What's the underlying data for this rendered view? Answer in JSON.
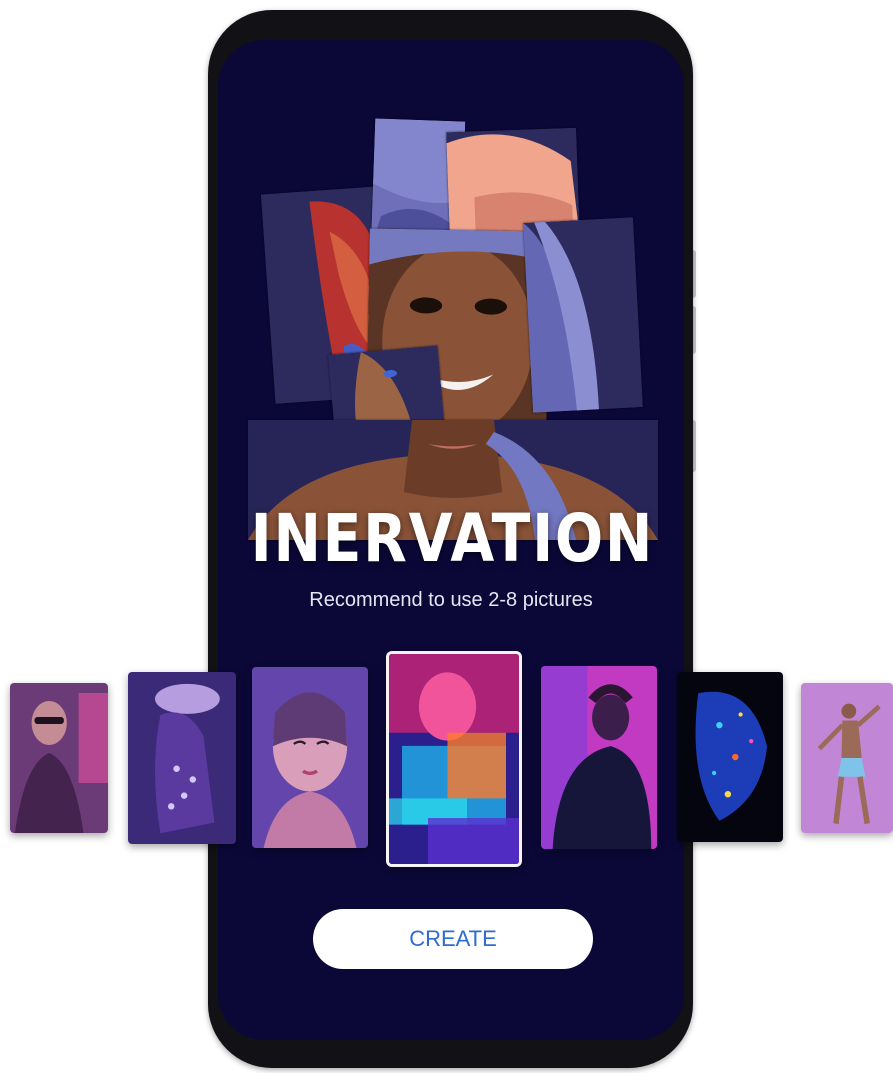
{
  "app": {
    "title": "INERVATION",
    "subtitle": "Recommend to use 2-8 pictures"
  },
  "carousel": {
    "selected_index": 3,
    "thumbnails": [
      {
        "name": "photo-woman-sunglasses-neon"
      },
      {
        "name": "photo-dancer-sequins"
      },
      {
        "name": "photo-woman-neon-portrait"
      },
      {
        "name": "photo-neon-glitch"
      },
      {
        "name": "photo-hoodie-back"
      },
      {
        "name": "photo-glitter-face"
      },
      {
        "name": "photo-dancer-pose"
      }
    ]
  },
  "actions": {
    "create_label": "CREATE"
  },
  "colors": {
    "screen_bg": "#0b0838",
    "button_text": "#2f6bd0",
    "frame": "#111116"
  }
}
